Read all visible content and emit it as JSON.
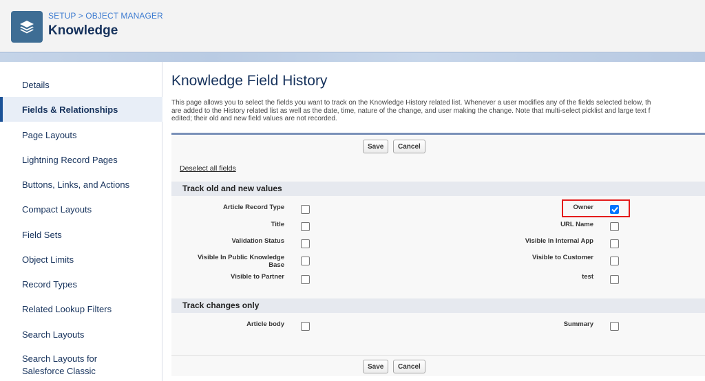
{
  "header": {
    "breadcrumb": "SETUP > OBJECT MANAGER",
    "object_title": "Knowledge"
  },
  "sidebar": {
    "items": [
      {
        "label": "Details"
      },
      {
        "label": "Fields & Relationships",
        "active": true
      },
      {
        "label": "Page Layouts"
      },
      {
        "label": "Lightning Record Pages"
      },
      {
        "label": "Buttons, Links, and Actions"
      },
      {
        "label": "Compact Layouts"
      },
      {
        "label": "Field Sets"
      },
      {
        "label": "Object Limits"
      },
      {
        "label": "Record Types"
      },
      {
        "label": "Related Lookup Filters"
      },
      {
        "label": "Search Layouts"
      },
      {
        "label": "Search Layouts for Salesforce Classic"
      }
    ]
  },
  "main": {
    "title": "Knowledge Field History",
    "description_lines": [
      "This page allows you to select the fields you want to track on the Knowledge History related list. Whenever a user modifies any of the fields selected below, th",
      "are added to the History related list as well as the date, time, nature of the change, and user making the change. Note that multi-select picklist and large text f",
      "edited; their old and new field values are not recorded."
    ],
    "save_label": "Save",
    "cancel_label": "Cancel",
    "deselect_label": "Deselect all fields",
    "section_old_new": "Track old and new values",
    "section_changes": "Track changes only",
    "fields_left": [
      {
        "label": "Article Record Type",
        "checked": false
      },
      {
        "label": "Title",
        "checked": false
      },
      {
        "label": "Validation Status",
        "checked": false
      },
      {
        "label": "Visible In Public Knowledge Base",
        "checked": false
      },
      {
        "label": "Visible to Partner",
        "checked": false
      }
    ],
    "fields_right": [
      {
        "label": "Owner",
        "checked": true
      },
      {
        "label": "URL Name",
        "checked": false
      },
      {
        "label": "Visible In Internal App",
        "checked": false
      },
      {
        "label": "Visible to Customer",
        "checked": false
      },
      {
        "label": "test",
        "checked": false
      }
    ],
    "changes_left": {
      "label": "Article body",
      "checked": false
    },
    "changes_right": {
      "label": "Summary",
      "checked": false
    }
  },
  "colors": {
    "accent": "#1b5297",
    "highlight": "#e41b1b",
    "checkbox_checked": "#0075ff"
  }
}
